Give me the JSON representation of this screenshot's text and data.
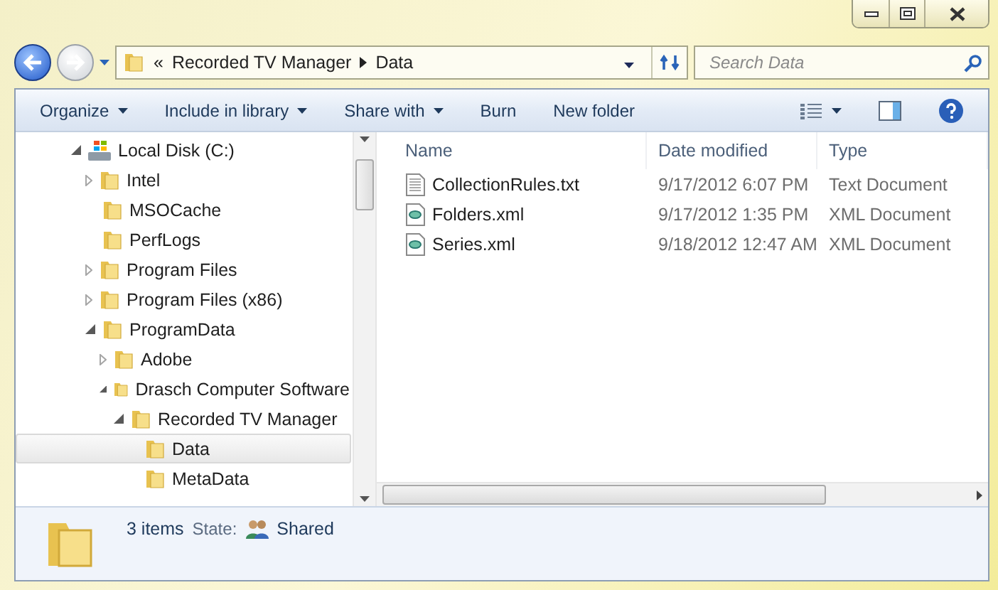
{
  "window": {
    "caption_buttons": [
      {
        "kind": "minimize"
      },
      {
        "kind": "maximize"
      },
      {
        "kind": "close"
      }
    ]
  },
  "address_bar": {
    "overflow": "«",
    "crumbs": [
      "Recorded TV Manager",
      "Data"
    ]
  },
  "search": {
    "placeholder": "Search Data"
  },
  "toolbar": {
    "items": [
      {
        "label": "Organize",
        "dropdown": true
      },
      {
        "label": "Include in library",
        "dropdown": true
      },
      {
        "label": "Share with",
        "dropdown": true
      },
      {
        "label": "Burn",
        "dropdown": false
      },
      {
        "label": "New folder",
        "dropdown": false
      }
    ]
  },
  "tree": [
    {
      "label": "Local Disk (C:)",
      "kind": "drive",
      "has_arrow": true,
      "expanded": true,
      "selected": false,
      "children": [
        {
          "label": "Intel",
          "kind": "folder",
          "has_arrow": true,
          "expanded": false,
          "selected": false
        },
        {
          "label": "MSOCache",
          "kind": "folder",
          "has_arrow": false,
          "selected": false
        },
        {
          "label": "PerfLogs",
          "kind": "folder",
          "has_arrow": false,
          "selected": false
        },
        {
          "label": "Program Files",
          "kind": "folder",
          "has_arrow": true,
          "expanded": false,
          "selected": false
        },
        {
          "label": "Program Files (x86)",
          "kind": "folder",
          "has_arrow": true,
          "expanded": false,
          "selected": false
        },
        {
          "label": "ProgramData",
          "kind": "folder",
          "has_arrow": true,
          "expanded": true,
          "selected": false,
          "children": [
            {
              "label": "Adobe",
              "kind": "folder",
              "has_arrow": true,
              "expanded": false,
              "selected": false
            },
            {
              "label": "Drasch Computer Software",
              "kind": "folder",
              "has_arrow": true,
              "expanded": true,
              "selected": false,
              "children": [
                {
                  "label": "Recorded TV Manager",
                  "kind": "folder",
                  "has_arrow": true,
                  "expanded": true,
                  "selected": false,
                  "children": [
                    {
                      "label": "Data",
                      "kind": "folder",
                      "has_arrow": false,
                      "selected": true
                    },
                    {
                      "label": "MetaData",
                      "kind": "folder",
                      "has_arrow": false,
                      "selected": false
                    }
                  ]
                }
              ]
            }
          ]
        }
      ]
    }
  ],
  "file_list": {
    "columns": [
      "Name",
      "Date modified",
      "Type"
    ],
    "rows": [
      {
        "kind": "text",
        "name": "CollectionRules.txt",
        "date": "9/17/2012 6:07 PM",
        "type": "Text Document"
      },
      {
        "kind": "xml",
        "name": "Folders.xml",
        "date": "9/17/2012 1:35 PM",
        "type": "XML Document"
      },
      {
        "kind": "xml",
        "name": "Series.xml",
        "date": "9/18/2012 12:47 AM",
        "type": "XML Document"
      }
    ]
  },
  "status_bar": {
    "count": "3 items",
    "state_label": "State:",
    "state": "Shared"
  }
}
